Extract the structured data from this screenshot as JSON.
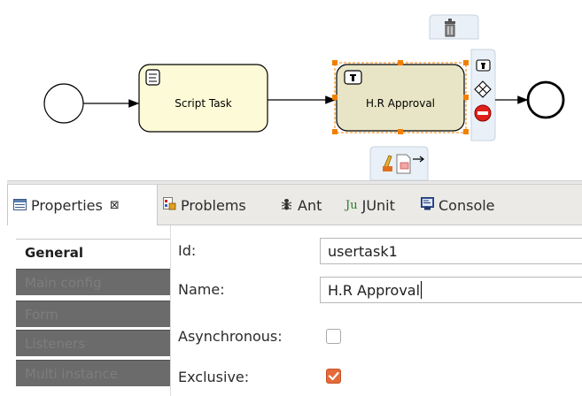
{
  "diagram": {
    "script_task": {
      "label": "Script Task",
      "icon": "script-icon"
    },
    "user_task": {
      "label": "H.R Approval",
      "icon": "user-task-icon",
      "selected": true
    },
    "context_pad": {
      "top": [
        "delete-icon"
      ],
      "right": [
        "user-task-icon",
        "gateway-icon",
        "end-event-icon"
      ],
      "bottom": [
        "edit-icon",
        "annotation-icon",
        "connect-arrow-icon"
      ]
    },
    "colors": {
      "task_fill": "#fdfbd7",
      "selected_task_fill": "#e8e5c6",
      "selection_handle": "#f08000",
      "context_pad_bg": "#e9f0f7"
    }
  },
  "tabs": [
    {
      "label": "Properties",
      "icon": "properties-icon",
      "close": "⊠",
      "active": true
    },
    {
      "label": "Problems",
      "icon": "problems-icon",
      "active": false
    },
    {
      "label": "Ant",
      "icon": "ant-icon",
      "active": false
    },
    {
      "label": "JUnit",
      "icon": "junit-icon",
      "prefix": "Ju",
      "active": false
    },
    {
      "label": "Console",
      "icon": "console-icon",
      "active": false
    }
  ],
  "sidebar": {
    "items": [
      {
        "label": "General",
        "active": true
      },
      {
        "label": "Main config",
        "active": false
      },
      {
        "label": "Form",
        "active": false
      },
      {
        "label": "Listeners",
        "active": false
      },
      {
        "label": "Multi instance",
        "active": false
      }
    ]
  },
  "fields": {
    "id": {
      "label": "Id:",
      "value": "usertask1"
    },
    "name": {
      "label": "Name:",
      "value": "H.R Approval"
    },
    "asynchronous": {
      "label": "Asynchronous:",
      "checked": false
    },
    "exclusive": {
      "label": "Exclusive:",
      "checked": true
    }
  }
}
